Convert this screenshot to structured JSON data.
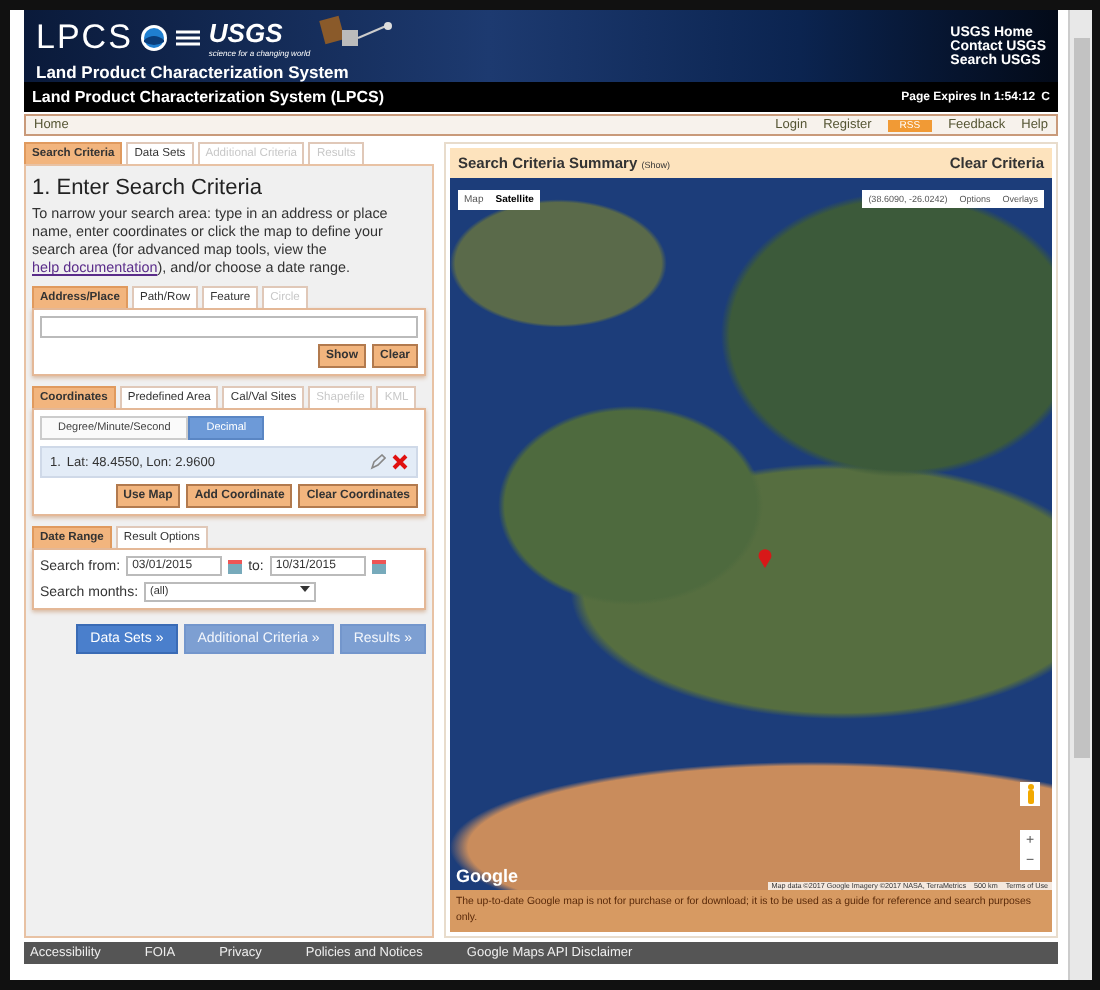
{
  "header": {
    "logo": "LPCS",
    "agency": "USGS",
    "tagline": "science for a changing world",
    "system_name": "Land Product Characterization System",
    "links": [
      "USGS Home",
      "Contact USGS",
      "Search USGS"
    ]
  },
  "title_bar": {
    "title": "Land Product Characterization System (LPCS)",
    "expires": "Page Expires In 1:54:12",
    "refresh": "C"
  },
  "nav": {
    "home": "Home",
    "links": [
      "Login",
      "Register"
    ],
    "rss": "RSS",
    "links_after": [
      "Feedback",
      "Help"
    ]
  },
  "main_tabs": [
    {
      "label": "Search Criteria",
      "selected": true,
      "disabled": false
    },
    {
      "label": "Data Sets",
      "selected": false,
      "disabled": false
    },
    {
      "label": "Additional Criteria",
      "selected": false,
      "disabled": true
    },
    {
      "label": "Results",
      "selected": false,
      "disabled": true
    }
  ],
  "heading": "1. Enter Search Criteria",
  "intro": "To narrow your search area: type in an address or place name, enter coordinates or click the map to define your search area (for advanced map tools, view the ",
  "intro_link": "help documentation",
  "intro_end": "), and/or choose a date range.",
  "area_tabs": [
    {
      "label": "Address/Place",
      "selected": true,
      "disabled": false
    },
    {
      "label": "Path/Row",
      "selected": false,
      "disabled": false
    },
    {
      "label": "Feature",
      "selected": false,
      "disabled": false
    },
    {
      "label": "Circle",
      "selected": false,
      "disabled": true
    }
  ],
  "address_buttons": [
    "Show",
    "Clear"
  ],
  "coord_tabs": [
    {
      "label": "Coordinates",
      "selected": true,
      "disabled": false
    },
    {
      "label": "Predefined Area",
      "selected": false,
      "disabled": false
    },
    {
      "label": "Cal/Val Sites",
      "selected": false,
      "disabled": false
    },
    {
      "label": "Shapefile",
      "selected": false,
      "disabled": true
    },
    {
      "label": "KML",
      "selected": false,
      "disabled": true
    }
  ],
  "formats": [
    {
      "label": "Degree/Minute/Second",
      "selected": false
    },
    {
      "label": "Decimal",
      "selected": true
    }
  ],
  "coordinates": [
    {
      "index": "1.",
      "text": "Lat: 48.4550, Lon: 2.9600"
    }
  ],
  "coord_buttons": [
    "Use Map",
    "Add Coordinate",
    "Clear Coordinates"
  ],
  "date_tabs": [
    {
      "label": "Date Range",
      "selected": true,
      "disabled": false
    },
    {
      "label": "Result Options",
      "selected": false,
      "disabled": false
    }
  ],
  "date": {
    "from_label": "Search from:",
    "from": "03/01/2015",
    "to_label": "to:",
    "to": "10/31/2015",
    "months_label": "Search months:",
    "months": "(all)"
  },
  "step_buttons": [
    {
      "label": "Data Sets »",
      "disabled": false
    },
    {
      "label": "Additional Criteria »",
      "disabled": true
    },
    {
      "label": "Results »",
      "disabled": true
    }
  ],
  "summary": {
    "title": "Search Criteria Summary",
    "toggle": "(Show)",
    "clear": "Clear Criteria"
  },
  "map": {
    "types": [
      {
        "label": "Map",
        "selected": false
      },
      {
        "label": "Satellite",
        "selected": true
      }
    ],
    "cursor": "(38.6090, -26.0242)",
    "options": "Options",
    "overlays": "Overlays",
    "zoom_in": "+",
    "zoom_out": "−",
    "logo": "Google",
    "attribution": "Map data ©2017 Google Imagery ©2017 NASA, TerraMetrics",
    "scale": "500 km",
    "terms": "Terms of Use"
  },
  "disclaimer": "The up-to-date Google map is not for purchase or for download; it is to be used as a guide for reference and search purposes only.",
  "footer": [
    "Accessibility",
    "FOIA",
    "Privacy",
    "Policies and Notices",
    "Google Maps API Disclaimer"
  ]
}
